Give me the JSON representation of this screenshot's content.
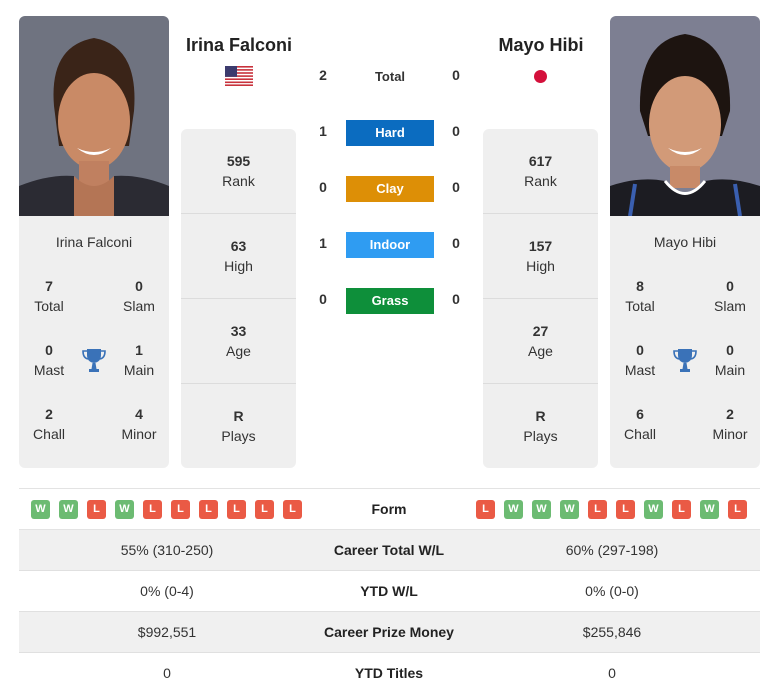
{
  "player1": {
    "name": "Irina Falconi",
    "flag": "usa-flag-icon",
    "card_name": "Irina Falconi",
    "titles": {
      "total": {
        "value": "7",
        "label": "Total"
      },
      "slam": {
        "value": "0",
        "label": "Slam"
      },
      "mast": {
        "value": "0",
        "label": "Mast"
      },
      "main": {
        "value": "1",
        "label": "Main"
      },
      "chall": {
        "value": "2",
        "label": "Chall"
      },
      "minor": {
        "value": "4",
        "label": "Minor"
      }
    },
    "stats": [
      {
        "value": "595",
        "label": "Rank"
      },
      {
        "value": "63",
        "label": "High"
      },
      {
        "value": "33",
        "label": "Age"
      },
      {
        "value": "R",
        "label": "Plays"
      }
    ],
    "form": [
      "W",
      "W",
      "L",
      "W",
      "L",
      "L",
      "L",
      "L",
      "L",
      "L"
    ]
  },
  "player2": {
    "name": "Mayo Hibi",
    "flag": "japan-flag-icon",
    "card_name": "Mayo Hibi",
    "titles": {
      "total": {
        "value": "8",
        "label": "Total"
      },
      "slam": {
        "value": "0",
        "label": "Slam"
      },
      "mast": {
        "value": "0",
        "label": "Mast"
      },
      "main": {
        "value": "0",
        "label": "Main"
      },
      "chall": {
        "value": "6",
        "label": "Chall"
      },
      "minor": {
        "value": "2",
        "label": "Minor"
      }
    },
    "stats": [
      {
        "value": "617",
        "label": "Rank"
      },
      {
        "value": "157",
        "label": "High"
      },
      {
        "value": "27",
        "label": "Age"
      },
      {
        "value": "R",
        "label": "Plays"
      }
    ],
    "form": [
      "L",
      "W",
      "W",
      "W",
      "L",
      "L",
      "W",
      "L",
      "W",
      "L"
    ]
  },
  "h2h": {
    "total": {
      "label": "Total",
      "p1": "2",
      "p2": "0"
    },
    "surfaces": [
      {
        "label": "Hard",
        "p1": "1",
        "p2": "0",
        "color": "#0b6cc0"
      },
      {
        "label": "Clay",
        "p1": "0",
        "p2": "0",
        "color": "#dd8f06"
      },
      {
        "label": "Indoor",
        "p1": "1",
        "p2": "0",
        "color": "#2f9cf2"
      },
      {
        "label": "Grass",
        "p1": "0",
        "p2": "0",
        "color": "#0e8f3a"
      }
    ]
  },
  "form_label": "Form",
  "comparison": [
    {
      "label": "Career Total W/L",
      "p1": "55% (310-250)",
      "p2": "60% (297-198)"
    },
    {
      "label": "YTD W/L",
      "p1": "0% (0-4)",
      "p2": "0% (0-0)"
    },
    {
      "label": "Career Prize Money",
      "p1": "$992,551",
      "p2": "$255,846"
    },
    {
      "label": "YTD Titles",
      "p1": "0",
      "p2": "0"
    }
  ]
}
